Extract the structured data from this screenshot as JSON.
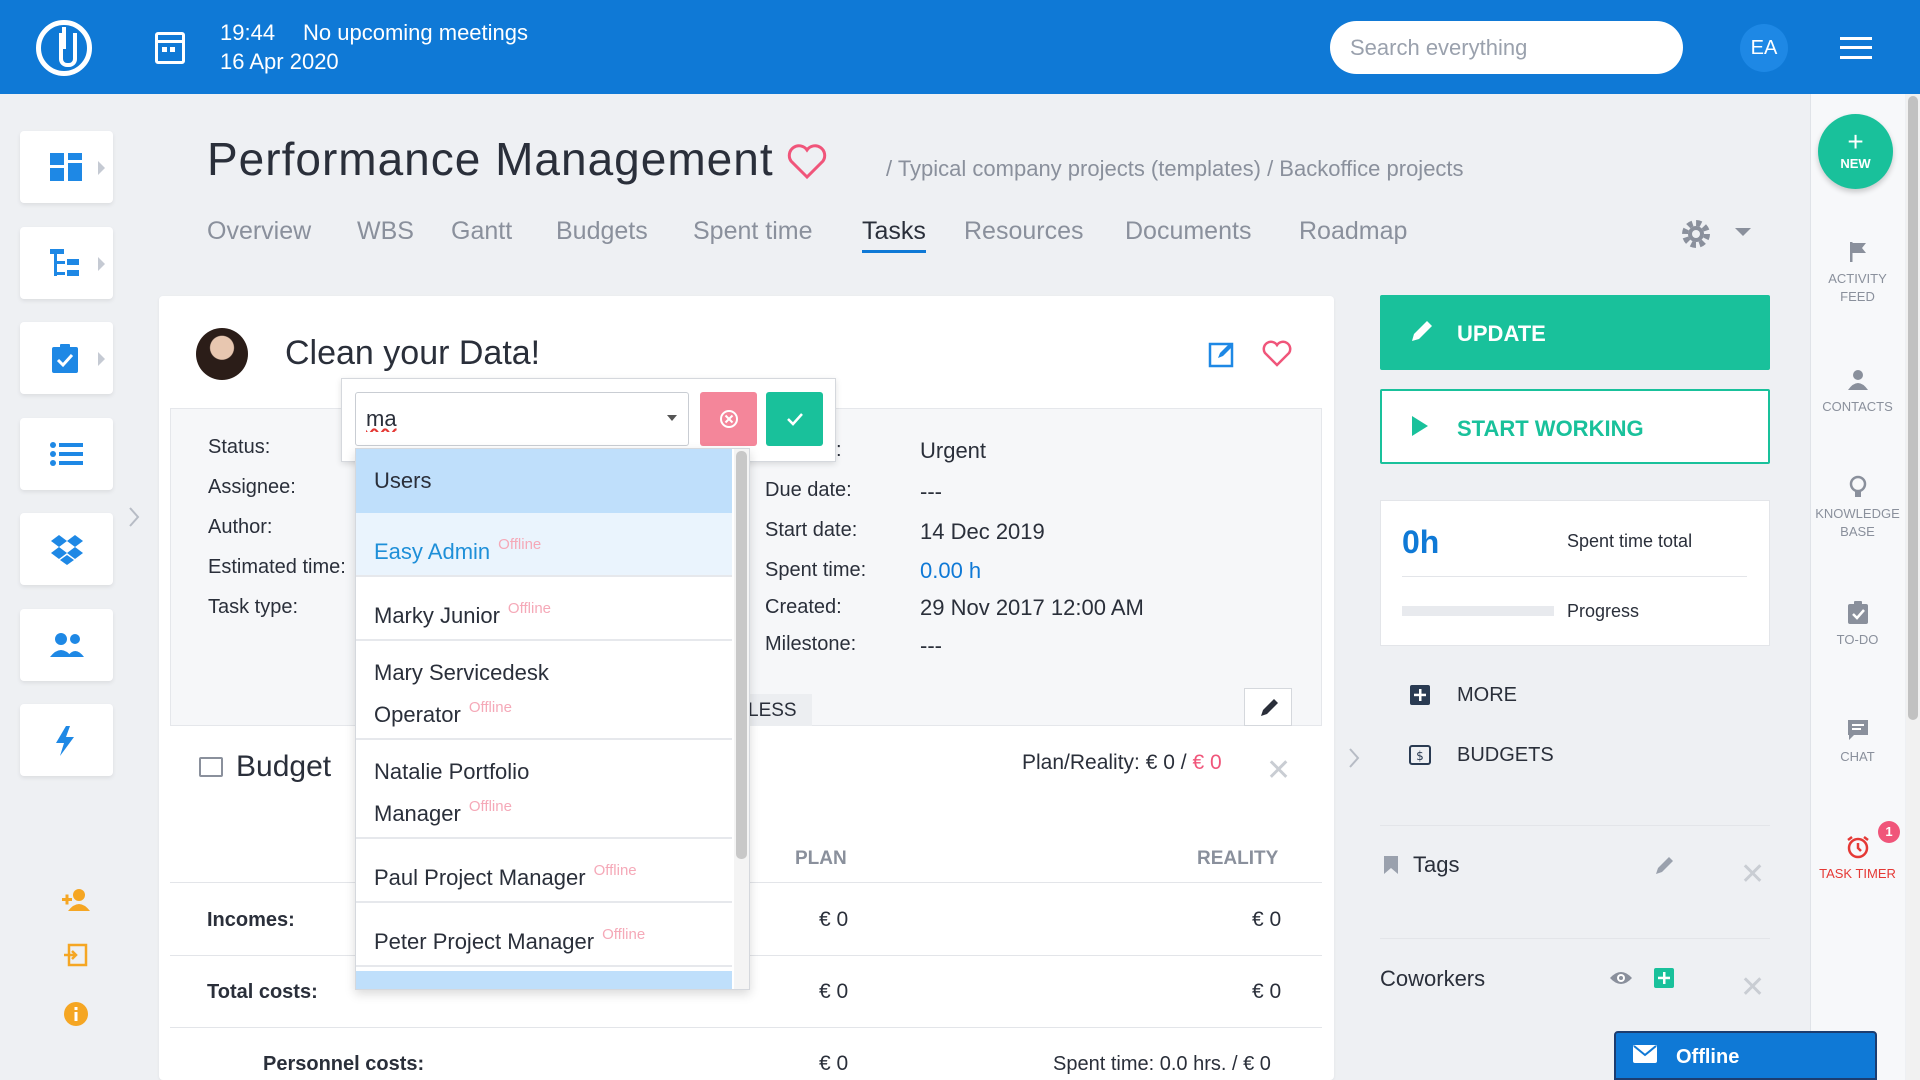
{
  "topbar": {
    "time": "19:44",
    "meetings": "No upcoming meetings",
    "date": "16 Apr 2020",
    "search_placeholder": "Search everything",
    "user_initials": "EA"
  },
  "project": {
    "title": "Performance Management",
    "breadcrumb": "/ Typical company projects (templates) / Backoffice projects"
  },
  "tabs": [
    "Overview",
    "WBS",
    "Gantt",
    "Budgets",
    "Spent time",
    "Tasks",
    "Resources",
    "Documents",
    "Roadmap"
  ],
  "task": {
    "title": "Clean your Data!",
    "left_labels": [
      "Status:",
      "Assignee:",
      "Author:",
      "Estimated time:",
      "Task type:"
    ],
    "priority_label_tail": ":",
    "priority_value": "Urgent",
    "due_date_label": "Due date:",
    "due_date_value": "---",
    "start_date_label": "Start date:",
    "start_date_value": "14 Dec 2019",
    "spent_time_label": "Spent time:",
    "spent_time_value": "0.00 h",
    "created_label": "Created:",
    "created_value": "29 Nov 2017 12:00 AM",
    "milestone_label": "Milestone:",
    "milestone_value": "---",
    "less_label": "LESS"
  },
  "dropdown": {
    "input_value": "ma",
    "group_header": "Users",
    "offline_label": "Offline",
    "items": [
      {
        "line1": "Easy Admin",
        "line2": ""
      },
      {
        "line1": "Marky Junior",
        "line2": ""
      },
      {
        "line1": "Mary Servicedesk",
        "line2": "Operator"
      },
      {
        "line1": "Natalie Portfolio",
        "line2": "Manager"
      },
      {
        "line1": "Paul Project Manager",
        "line2": ""
      },
      {
        "line1": "Peter Project Manager",
        "line2": ""
      }
    ]
  },
  "budget": {
    "title": "Budget",
    "plan_reality_label": "Plan/Reality: € 0 /",
    "plan_reality_value": "€ 0",
    "col_plan": "PLAN",
    "col_reality": "REALITY",
    "rows": [
      {
        "label": "Incomes:",
        "plan": "€ 0",
        "reality": "€ 0"
      },
      {
        "label": "Total costs:",
        "plan": "€ 0",
        "reality": "€ 0"
      },
      {
        "label": "Personnel costs:",
        "plan": "€ 0",
        "reality": "Spent time: 0.0 hrs. / € 0"
      }
    ]
  },
  "right_panel": {
    "update_label": "UPDATE",
    "start_label": "START WORKING",
    "spent_value": "0h",
    "spent_label": "Spent time total",
    "progress_label": "Progress",
    "progress_value": 0,
    "more_label": "MORE",
    "budgets_label": "BUDGETS",
    "tags_label": "Tags",
    "coworkers_label": "Coworkers"
  },
  "right_sidebar": {
    "new_label": "NEW",
    "items": [
      {
        "line1": "ACTIVITY",
        "line2": "FEED"
      },
      {
        "line1": "CONTACTS",
        "line2": ""
      },
      {
        "line1": "KNOWLEDGE",
        "line2": "BASE"
      },
      {
        "line1": "TO-DO",
        "line2": ""
      },
      {
        "line1": "CHAT",
        "line2": ""
      },
      {
        "line1": "TASK TIMER",
        "line2": ""
      }
    ],
    "timer_badge": "1"
  },
  "chat_chip": {
    "label": "Offline"
  },
  "colors": {
    "primary": "#0f79d6",
    "accent_green": "#19c19b",
    "pink": "#f0557a",
    "timer_red": "#e53935"
  }
}
